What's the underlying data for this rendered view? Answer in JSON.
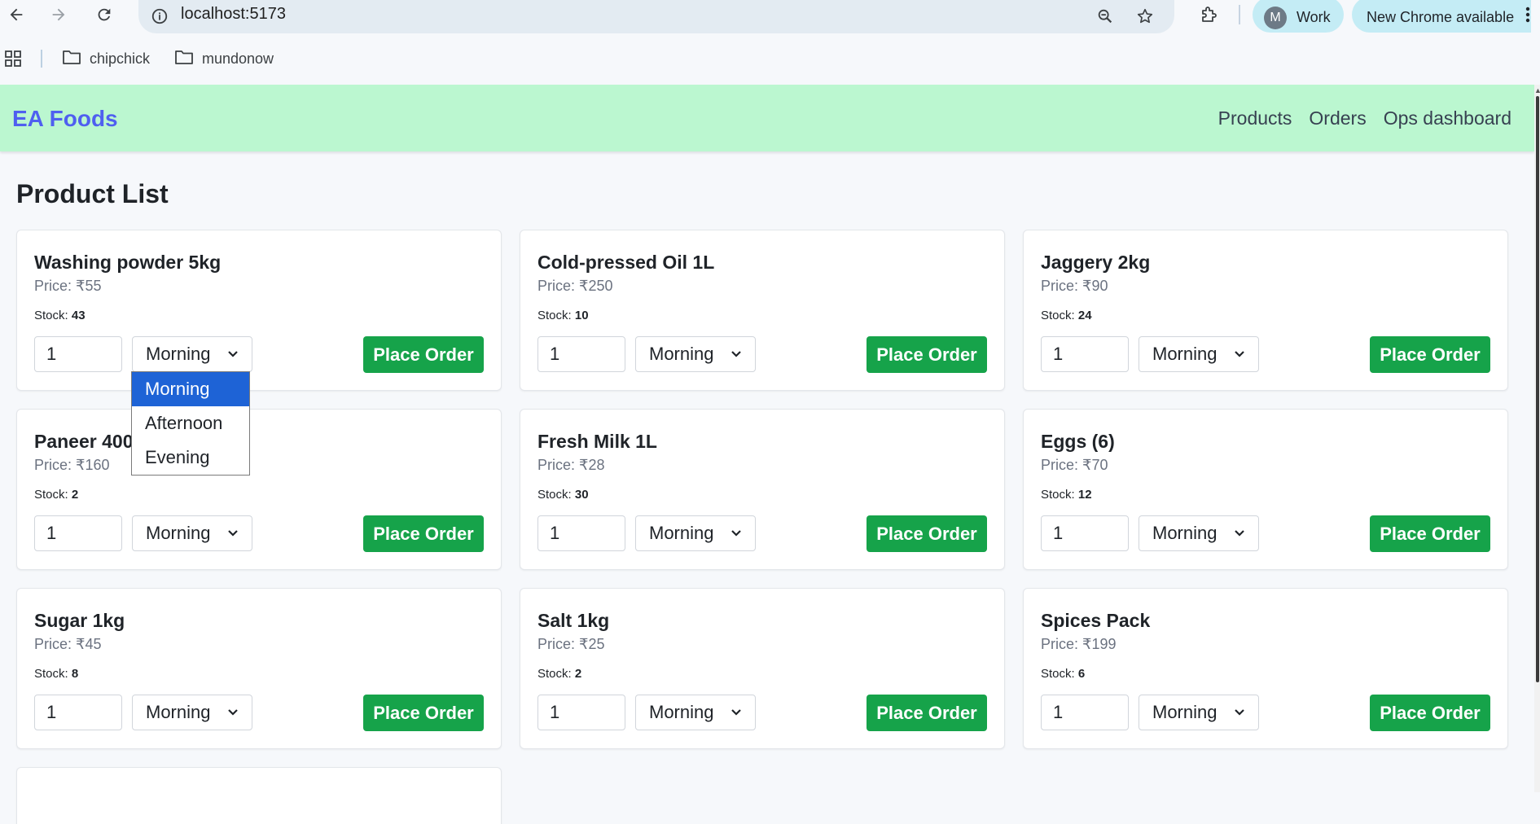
{
  "browser": {
    "url": "localhost:5173",
    "profile": {
      "initial": "M",
      "name": "Work"
    },
    "update_text": "New Chrome available",
    "bookmarks": [
      {
        "label": "chipchick"
      },
      {
        "label": "mundonow"
      }
    ]
  },
  "app": {
    "brand": "EA Foods",
    "nav": [
      {
        "label": "Products"
      },
      {
        "label": "Orders"
      },
      {
        "label": "Ops dashboard"
      }
    ],
    "page_title": "Product List",
    "labels": {
      "price_prefix": "Price: ",
      "stock": "Stock: ",
      "order_button": "Place Order"
    },
    "products": [
      {
        "name": "Washing powder 5kg",
        "price": "₹55",
        "stock": "43",
        "qty": "1",
        "slot": "Morning"
      },
      {
        "name": "Cold-pressed Oil 1L",
        "price": "₹250",
        "stock": "10",
        "qty": "1",
        "slot": "Morning"
      },
      {
        "name": "Jaggery 2kg",
        "price": "₹90",
        "stock": "24",
        "qty": "1",
        "slot": "Morning"
      },
      {
        "name": "Paneer 400g",
        "price": "₹160",
        "stock": "2",
        "qty": "1",
        "slot": "Morning"
      },
      {
        "name": "Fresh Milk 1L",
        "price": "₹28",
        "stock": "30",
        "qty": "1",
        "slot": "Morning"
      },
      {
        "name": "Eggs (6)",
        "price": "₹70",
        "stock": "12",
        "qty": "1",
        "slot": "Morning"
      },
      {
        "name": "Sugar 1kg",
        "price": "₹45",
        "stock": "8",
        "qty": "1",
        "slot": "Morning"
      },
      {
        "name": "Salt 1kg",
        "price": "₹25",
        "stock": "2",
        "qty": "1",
        "slot": "Morning"
      },
      {
        "name": "Spices Pack",
        "price": "₹199",
        "stock": "6",
        "qty": "1",
        "slot": "Morning"
      }
    ],
    "slot_dropdown": {
      "options": [
        "Morning",
        "Afternoon",
        "Evening"
      ],
      "selected": "Morning",
      "highlight_color": "#1e63d6"
    },
    "colors": {
      "nav_bg": "#bbf7d0",
      "brand": "#4f5ff0",
      "order_button": "#16a34a"
    }
  }
}
